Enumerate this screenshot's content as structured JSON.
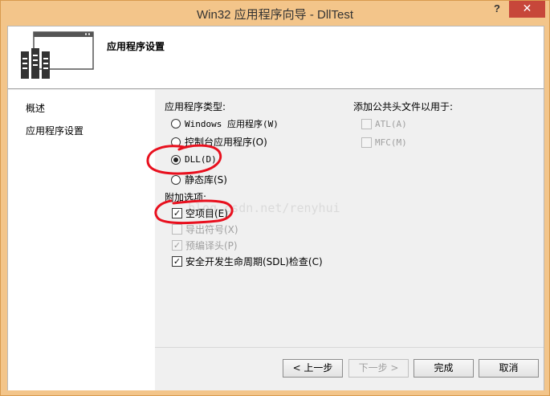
{
  "window": {
    "title": "Win32 应用程序向导 - DllTest",
    "help_label": "?",
    "close_label": "✕"
  },
  "header": {
    "title": "应用程序设置"
  },
  "nav": {
    "items": [
      {
        "label": "概述"
      },
      {
        "label": "应用程序设置"
      }
    ]
  },
  "app_type": {
    "heading": "应用程序类型:",
    "options": [
      {
        "label": "Windows 应用程序(W)",
        "checked": false
      },
      {
        "label": "控制台应用程序(O)",
        "checked": false
      },
      {
        "label": "DLL(D)",
        "checked": true
      },
      {
        "label": "静态库(S)",
        "checked": false
      }
    ]
  },
  "extra": {
    "heading": "附加选项:",
    "options": [
      {
        "label": "空项目(E)",
        "checked": true,
        "enabled": true
      },
      {
        "label": "导出符号(X)",
        "checked": false,
        "enabled": false
      },
      {
        "label": "预编译头(P)",
        "checked": true,
        "enabled": false
      },
      {
        "label": "安全开发生命周期(SDL)检查(C)",
        "checked": true,
        "enabled": true
      }
    ]
  },
  "common_headers": {
    "heading": "添加公共头文件以用于:",
    "options": [
      {
        "label": "ATL(A)",
        "checked": false,
        "enabled": false
      },
      {
        "label": "MFC(M)",
        "checked": false,
        "enabled": false
      }
    ]
  },
  "buttons": {
    "prev": "< 上一步",
    "next": "下一步 >",
    "finish": "完成",
    "cancel": "取消"
  },
  "watermark": "blog.csdn.net/renyhui",
  "colors": {
    "frame": "#f3c58a",
    "close": "#c7473a",
    "annotation": "#e8101e"
  }
}
